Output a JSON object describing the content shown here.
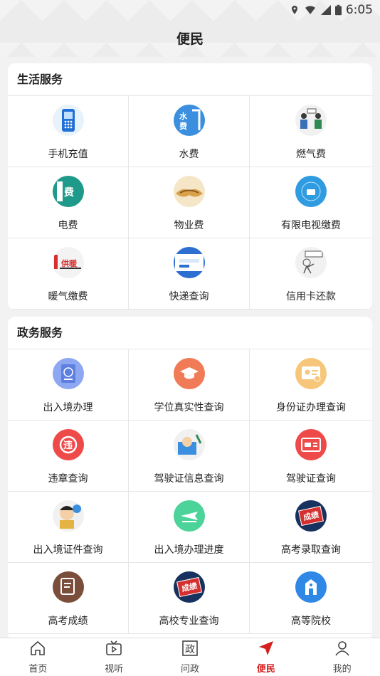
{
  "status_bar": {
    "time": "6:05"
  },
  "header": {
    "title": "便民"
  },
  "life_services": {
    "title": "生活服务",
    "items": [
      {
        "label": "手机充值",
        "icon": "phone-recharge-icon",
        "color": "#e8f2fb"
      },
      {
        "label": "水费",
        "icon": "water-bill-icon",
        "color": "#3b8fde"
      },
      {
        "label": "燃气费",
        "icon": "gas-bill-icon",
        "color": "#f1f1f1"
      },
      {
        "label": "电费",
        "icon": "electricity-bill-icon",
        "color": "#1f9a8a"
      },
      {
        "label": "物业费",
        "icon": "property-fee-icon",
        "color": "#f5e6c8"
      },
      {
        "label": "有限电视缴费",
        "icon": "cable-tv-icon",
        "color": "#2f9be0"
      },
      {
        "label": "暖气缴费",
        "icon": "heating-fee-icon",
        "color": "#f3f3f3"
      },
      {
        "label": "快递查询",
        "icon": "express-query-icon",
        "color": "#2d6fd0"
      },
      {
        "label": "信用卡还款",
        "icon": "credit-card-icon",
        "color": "#f1f1f1"
      }
    ]
  },
  "gov_services": {
    "title": "政务服务",
    "items": [
      {
        "label": "出入境办理",
        "icon": "passport-icon",
        "color": "#8ea7f2"
      },
      {
        "label": "学位真实性查询",
        "icon": "graduation-cap-icon",
        "color": "#f17a57"
      },
      {
        "label": "身份证办理查询",
        "icon": "id-card-icon",
        "color": "#f6c77a"
      },
      {
        "label": "违章查询",
        "icon": "violation-icon",
        "color": "#ef4a4a"
      },
      {
        "label": "驾驶证信息查询",
        "icon": "driver-info-icon",
        "color": "#f1f1f1"
      },
      {
        "label": "驾驶证查询",
        "icon": "driver-license-icon",
        "color": "#ef4a4a"
      },
      {
        "label": "出入境证件查询",
        "icon": "immigration-doc-icon",
        "color": "#f1f1f1"
      },
      {
        "label": "出入境办理进度",
        "icon": "flight-progress-icon",
        "color": "#4bd39a"
      },
      {
        "label": "高考录取查询",
        "icon": "exam-admission-icon",
        "color": "#17325e"
      },
      {
        "label": "高考成绩",
        "icon": "exam-score-icon",
        "color": "#7a4e3a"
      },
      {
        "label": "高校专业查询",
        "icon": "major-query-icon",
        "color": "#17325e"
      },
      {
        "label": "高等院校",
        "icon": "university-icon",
        "color": "#2f87e6"
      }
    ],
    "glyphs": {
      "exam-admission-icon": "成绩",
      "major-query-icon": "成绩"
    }
  },
  "bottom_nav": {
    "items": [
      {
        "label": "首页",
        "icon": "home-icon",
        "active": false
      },
      {
        "label": "视听",
        "icon": "tv-icon",
        "active": false
      },
      {
        "label": "问政",
        "icon": "politics-icon",
        "active": false,
        "glyph": "政"
      },
      {
        "label": "便民",
        "icon": "send-icon",
        "active": true
      },
      {
        "label": "我的",
        "icon": "user-icon",
        "active": false
      }
    ],
    "active_color": "#d71f1f"
  }
}
